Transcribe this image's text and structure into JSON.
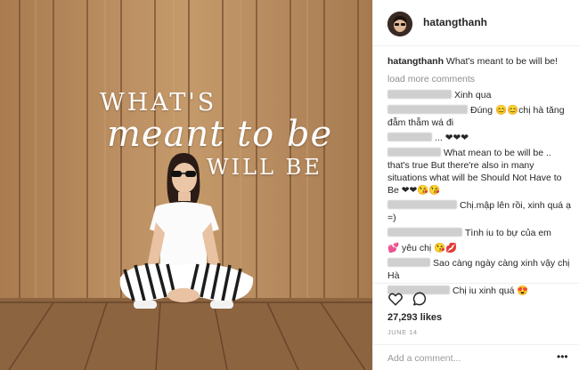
{
  "photo": {
    "overlay_line1": "WHAT'S",
    "overlay_line2": "meant to be",
    "overlay_line3": "WILL BE",
    "wood_color": "#b8895b",
    "floor_color": "#8c6440"
  },
  "post": {
    "username": "hatangthanh",
    "caption_user": "hatangthanh",
    "caption_text": "What's meant to be will be!",
    "load_more": "load more comments",
    "comments": [
      {
        "text": "Xinh qua"
      },
      {
        "text": "Đúng 😊😊chị hà tăng đẫm thẫm wá đi"
      },
      {
        "text": "..."
      },
      {
        "text": "❤❤❤"
      },
      {
        "text": "What mean to be will be .. that's true But there're also in many situations what will be Should Not Have to Be ❤❤😘😘"
      },
      {
        "text": "Chị.mập lên rồi, xinh quá ạ =)"
      },
      {
        "text": "Tình iu to bự của em"
      },
      {
        "text": "💕 yêu chị 😘💋"
      },
      {
        "text": "Sao càng ngày càng xinh vậy chị Hà"
      },
      {
        "text": "Chị iu xinh quá 😍"
      }
    ],
    "likes": "27,293 likes",
    "date": "JUNE 14",
    "add_comment_placeholder": "Add a comment...",
    "more_label": "•••"
  },
  "icons": {
    "like": "heart-icon",
    "comment": "comment-icon",
    "more": "more-options-icon"
  }
}
